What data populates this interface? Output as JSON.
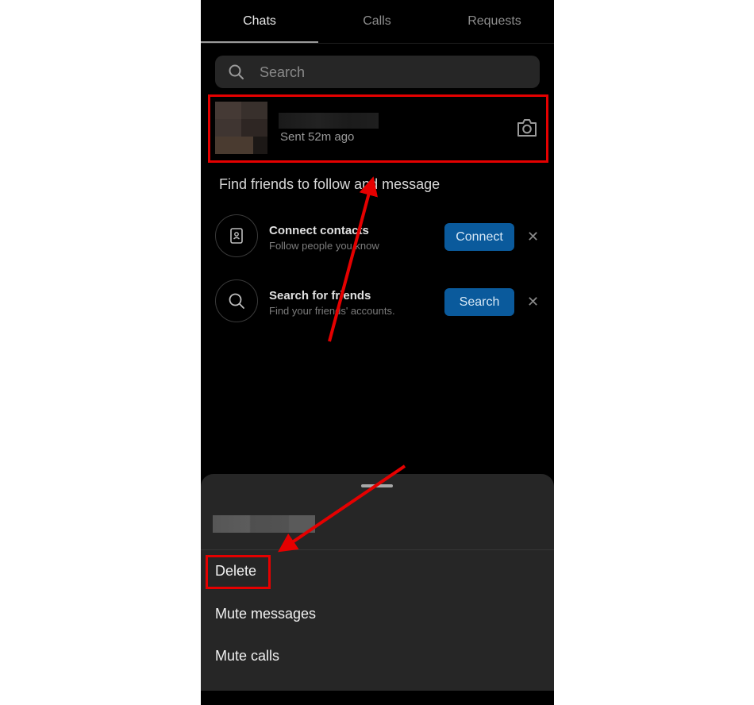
{
  "tabs": [
    {
      "label": "Chats",
      "active": true
    },
    {
      "label": "Calls",
      "active": false
    },
    {
      "label": "Requests",
      "active": false
    }
  ],
  "search": {
    "placeholder": "Search",
    "icon": "search-icon"
  },
  "conversation": {
    "status": "Sent 52m ago",
    "action_icon": "camera-icon"
  },
  "find_friends": {
    "title": "Find friends to follow and message",
    "suggestions": [
      {
        "title": "Connect contacts",
        "subtitle": "Follow people you know",
        "button": "Connect",
        "dismiss": "✕",
        "icon": "contact-card-icon"
      },
      {
        "title": "Search for friends",
        "subtitle": "Find your friends' accounts.",
        "button": "Search",
        "dismiss": "✕",
        "icon": "search-icon"
      }
    ]
  },
  "sheet": {
    "menu": [
      "Delete",
      "Mute messages",
      "Mute calls"
    ]
  },
  "colors": {
    "background": "#000000",
    "sheet": "#262626",
    "button_blue": "#0a5a9c",
    "annotation_red": "#e50000"
  }
}
